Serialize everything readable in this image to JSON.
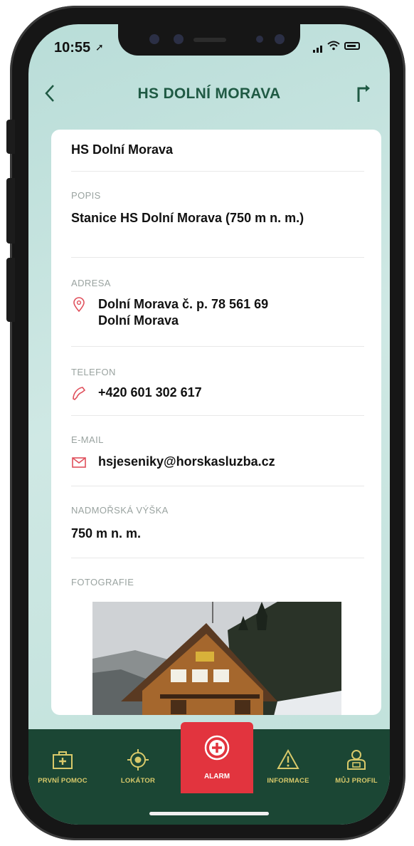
{
  "status": {
    "time": "10:55"
  },
  "header": {
    "title": "HS DOLNÍ MORAVA"
  },
  "detail": {
    "name": "HS Dolní Morava",
    "description": {
      "label": "POPIS",
      "value": "Stanice HS Dolní Morava (750 m n. m.)"
    },
    "address": {
      "label": "ADRESA",
      "line1": "Dolní Morava č. p. 78  561 69",
      "line2": "Dolní Morava"
    },
    "phone": {
      "label": "TELEFON",
      "value": "+420 601 302 617"
    },
    "email": {
      "label": "E-MAIL",
      "value": "hsjeseniky@horskasluzba.cz"
    },
    "altitude": {
      "label": "NADMOŘSKÁ VÝŠKA",
      "value": "750 m n. m."
    },
    "photos": {
      "label": "FOTOGRAFIE"
    }
  },
  "tabs": [
    {
      "label": "PRVNÍ POMOC",
      "icon": "first-aid-kit-icon"
    },
    {
      "label": "LOKÁTOR",
      "icon": "locator-target-icon"
    },
    {
      "label": "ALARM",
      "icon": "alarm-plus-icon"
    },
    {
      "label": "INFORMACE",
      "icon": "warning-triangle-icon"
    },
    {
      "label": "MŮJ PROFIL",
      "icon": "profile-icon"
    }
  ],
  "colors": {
    "primary_green": "#1f5a44",
    "tab_bar": "#1b4634",
    "tab_label": "#d8c96a",
    "alarm_red": "#e2343e",
    "accent_red": "#e0505c"
  }
}
